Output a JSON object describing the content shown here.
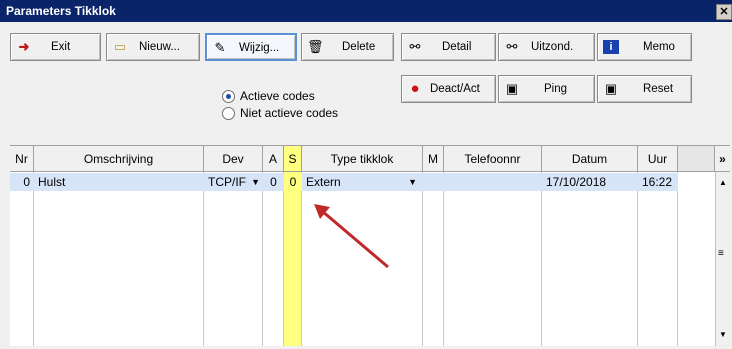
{
  "window": {
    "title": "Parameters Tikklok",
    "close": "✕"
  },
  "toolbar": {
    "exit": "Exit",
    "nieuw": "Nieuw...",
    "wijzig": "Wijzig...",
    "delete": "Delete",
    "detail": "Detail",
    "uitzond": "Uitzond.",
    "memo": "Memo",
    "deact": "Deact/Act",
    "ping": "Ping",
    "reset": "Reset"
  },
  "filter": {
    "option1": "Actieve codes",
    "option2": "Niet actieve codes",
    "selected": "Actieve codes"
  },
  "table": {
    "headers": [
      "Nr",
      "Omschrijving",
      "Dev",
      "A",
      "S",
      "Type tikklok",
      "M",
      "Telefoonnr",
      "Datum",
      "Uur"
    ],
    "more": "»",
    "rows": [
      {
        "nr": "0",
        "omschrijving": "Hulst",
        "dev": "TCP/IF",
        "a": "0",
        "s": "0",
        "type": "Extern",
        "m": "",
        "telefoonnr": "",
        "datum": "17/10/2018",
        "uur": "16:22"
      }
    ]
  },
  "colors": {
    "titlebar": "#0a246a",
    "highlight": "#ffff80",
    "arrow": "#c0282a",
    "selected_row": "#d7e4f7"
  }
}
